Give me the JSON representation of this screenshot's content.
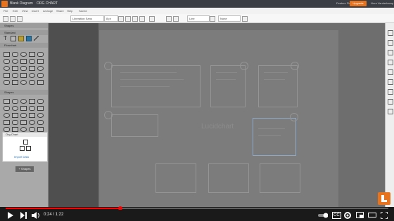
{
  "app": {
    "title": "Blank Diagram",
    "group": "ORG CHART",
    "feature_find": "Feature Find",
    "upgrade": "Upgrade",
    "user": "Nora Vanderkamp"
  },
  "menu": [
    "File",
    "Edit",
    "View",
    "Insert",
    "Arrange",
    "Share",
    "Help",
    "Saved"
  ],
  "toolbar": {
    "font": "Liberation Sans",
    "font_size": "8 pt",
    "line_field": "Line",
    "arrow_field": "None"
  },
  "left_panel": {
    "shapes_header": "Shapes",
    "standard_header": "Standard",
    "flowchart_header": "Flowchart",
    "shapes_section": "Shapes",
    "org_chart_header": "Org Chart",
    "import_label": "Import Data",
    "more_shapes_button": "+ Shapes"
  },
  "canvas": {
    "watermark": "Lucidchart"
  },
  "player": {
    "time_current": "0:24",
    "time_total": "1:22",
    "time_display": "0:24 / 1:22",
    "progress": 0.29,
    "brand_color": "#e8731f",
    "progress_color": "#ff0000"
  }
}
